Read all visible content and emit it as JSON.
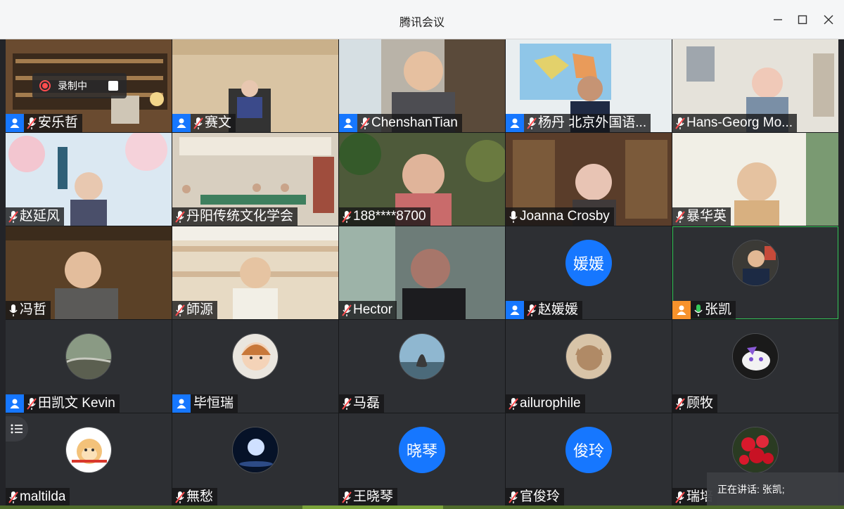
{
  "window": {
    "title": "腾讯会议"
  },
  "recording": {
    "label": "录制中"
  },
  "speaking": {
    "label": "正在讲话: 张凯;"
  },
  "colors": {
    "accent": "#1677ff",
    "host_orange": "#f7922b",
    "speaking_green": "#34c759",
    "muted_red": "#ff4d4f"
  },
  "participants": [
    {
      "name": "安乐哲",
      "host": true,
      "mic": "muted",
      "kind": "video",
      "scene": "library"
    },
    {
      "name": "赛文",
      "host": true,
      "mic": "muted",
      "kind": "video",
      "scene": "office"
    },
    {
      "name": "ChenshanTian",
      "host": true,
      "mic": "muted",
      "kind": "video",
      "scene": "bookshelf"
    },
    {
      "name": "杨丹 北京外国语...",
      "host": true,
      "mic": "muted",
      "kind": "video",
      "scene": "map"
    },
    {
      "name": "Hans-Georg Mo...",
      "host": false,
      "mic": "muted",
      "kind": "video",
      "scene": "room"
    },
    {
      "name": "赵延风",
      "host": false,
      "mic": "muted",
      "kind": "video",
      "scene": "blossom"
    },
    {
      "name": "丹阳传统文化学会",
      "host": false,
      "mic": "muted",
      "kind": "video",
      "scene": "classroom"
    },
    {
      "name": "188****8700",
      "host": false,
      "mic": "muted",
      "kind": "video",
      "scene": "plants"
    },
    {
      "name": "Joanna Crosby",
      "host": false,
      "mic": "on",
      "kind": "video",
      "scene": "bookshelf2"
    },
    {
      "name": "暴华英",
      "host": false,
      "mic": "muted",
      "kind": "video",
      "scene": "bright"
    },
    {
      "name": "冯哲",
      "host": false,
      "mic": "on",
      "kind": "video",
      "scene": "library2"
    },
    {
      "name": "師源",
      "host": false,
      "mic": "muted",
      "kind": "video",
      "scene": "shelves"
    },
    {
      "name": "Hector",
      "host": false,
      "mic": "muted",
      "kind": "video",
      "scene": "window"
    },
    {
      "name": "赵媛媛",
      "host": true,
      "mic": "muted",
      "kind": "text-avatar",
      "avatar_text": "媛媛"
    },
    {
      "name": "张凯",
      "host": true,
      "host_color": "orange",
      "mic": "speaking",
      "kind": "img-avatar",
      "avatar_icon": "person-photo-icon",
      "speaking": true
    },
    {
      "name": "田凯文 Kevin",
      "host": true,
      "mic": "muted",
      "kind": "img-avatar",
      "avatar_icon": "landscape-photo-icon"
    },
    {
      "name": "毕恒瑞",
      "host": true,
      "mic": "none",
      "kind": "img-avatar",
      "avatar_icon": "cartoon-girl-icon"
    },
    {
      "name": "马磊",
      "host": false,
      "mic": "muted",
      "kind": "img-avatar",
      "avatar_icon": "mermaid-statue-icon"
    },
    {
      "name": "ailurophile",
      "host": false,
      "mic": "muted",
      "kind": "img-avatar",
      "avatar_icon": "cat-photo-icon"
    },
    {
      "name": "顾牧",
      "host": false,
      "mic": "muted",
      "kind": "img-avatar",
      "avatar_icon": "cartoon-creature-icon"
    },
    {
      "name": "maltilda",
      "host": false,
      "mic": "muted",
      "kind": "img-avatar",
      "avatar_icon": "monkey-king-icon"
    },
    {
      "name": "無愁",
      "host": false,
      "mic": "muted",
      "kind": "img-avatar",
      "avatar_icon": "moon-night-icon"
    },
    {
      "name": "王晓琴",
      "host": false,
      "mic": "muted",
      "kind": "text-avatar",
      "avatar_text": "晓琴"
    },
    {
      "name": "官俊玲",
      "host": false,
      "mic": "muted",
      "kind": "text-avatar",
      "avatar_text": "俊玲"
    },
    {
      "name": "瑞培",
      "host": false,
      "mic": "muted",
      "kind": "img-avatar",
      "avatar_icon": "red-flowers-icon"
    }
  ]
}
